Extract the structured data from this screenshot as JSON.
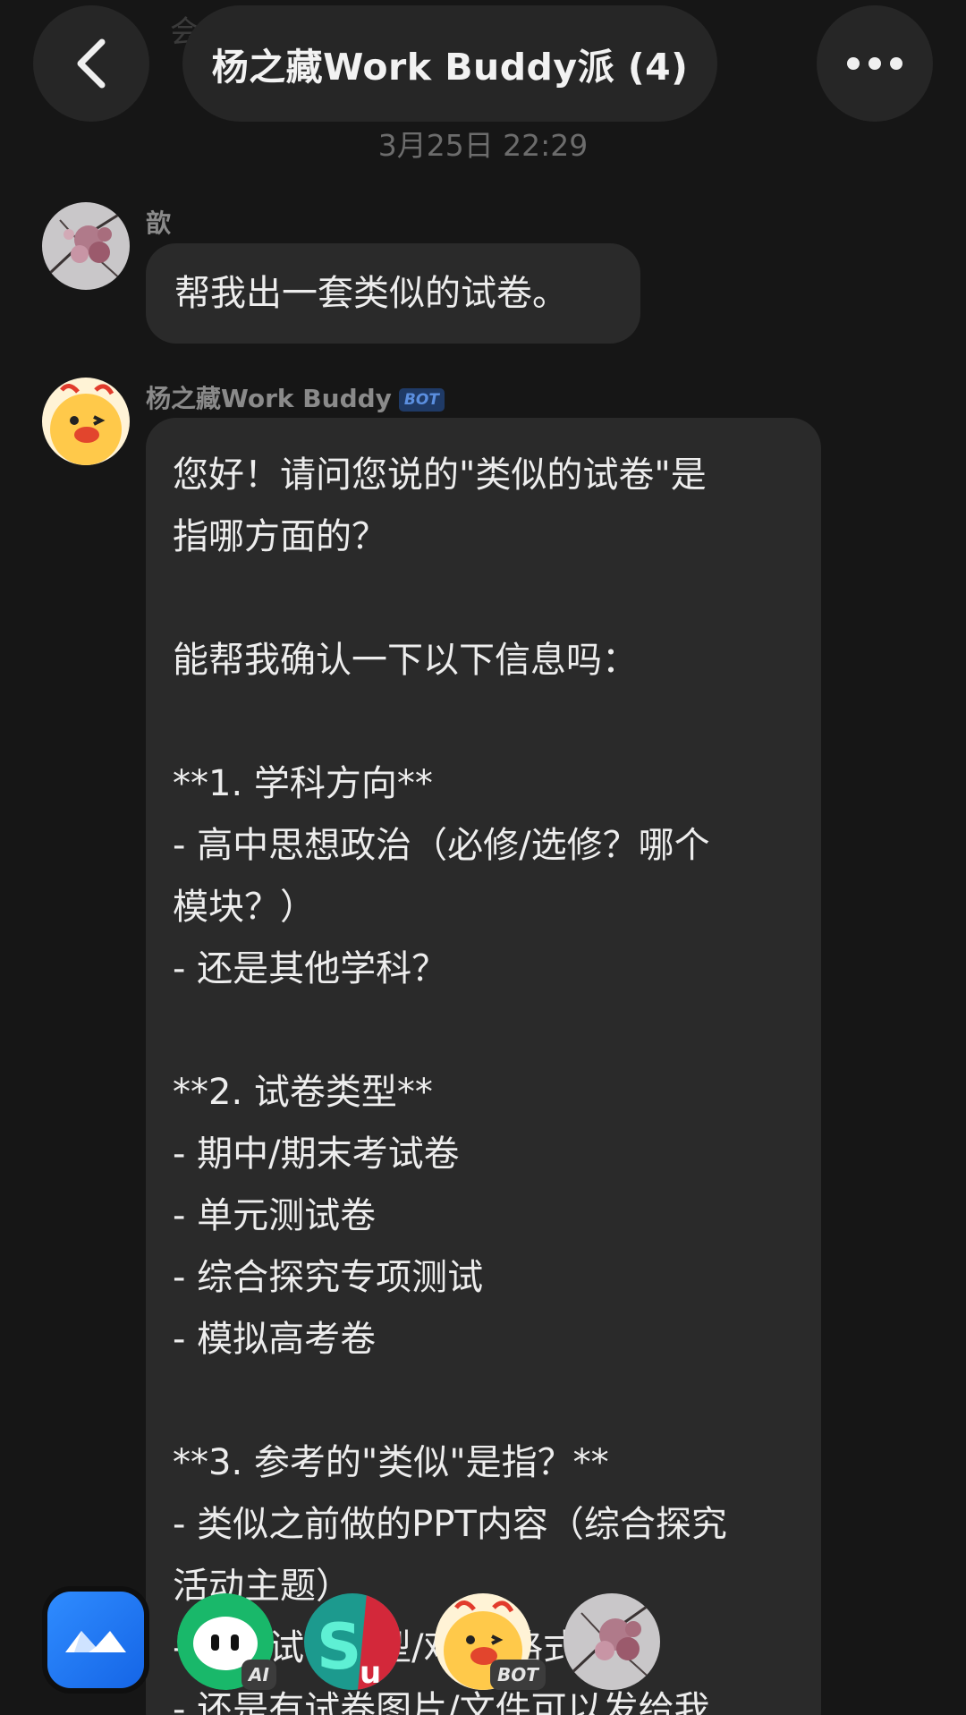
{
  "header": {
    "title": "杨之藏Work Buddy派 (4)",
    "ghost_text": "会",
    "back_icon": "chevron-left-icon",
    "more_icon": "ellipsis-icon"
  },
  "timestamp": "3月25日 22:29",
  "messages": [
    {
      "sender": "歆",
      "avatar": "cherry-blossom-avatar",
      "text": "帮我出一套类似的试卷。"
    },
    {
      "sender": "杨之藏Work Buddy",
      "badge": "BOT",
      "avatar": "yellow-chick-avatar",
      "lines": [
        "您好！请问您说的\"类似的试卷\"是",
        "指哪方面的？",
        "",
        "能帮我确认一下以下信息吗：",
        "",
        "**1. 学科方向**",
        "- 高中思想政治（必修/选修？哪个",
        "模块？）",
        "- 还是其他学科？",
        "",
        "**2. 试卷类型**",
        "- 期中/期末考试卷",
        "- 单元测试卷",
        "- 综合探究专项测试",
        "- 模拟高考卷",
        "",
        "**3. 参考的\"类似\"是指？**",
        "- 类似之前做的PPT内容（综合探究",
        "活动主题）",
        "- 具体试卷题型/难度/格式",
        "- 还是有试卷图片/文件可以发给我"
      ]
    }
  ],
  "dock": [
    {
      "name": "blue-app-icon",
      "badge": ""
    },
    {
      "name": "green-ai-avatar",
      "badge": "AI"
    },
    {
      "name": "su-avatar",
      "badge": ""
    },
    {
      "name": "yellow-chick-bot-avatar",
      "badge": "BOT"
    },
    {
      "name": "cherry-blossom-avatar",
      "badge": ""
    }
  ],
  "colors": {
    "background": "#161616",
    "bubble": "#2a2a2a",
    "accent_blue": "#2f8cff",
    "bot_badge": "#5b8fe0"
  }
}
